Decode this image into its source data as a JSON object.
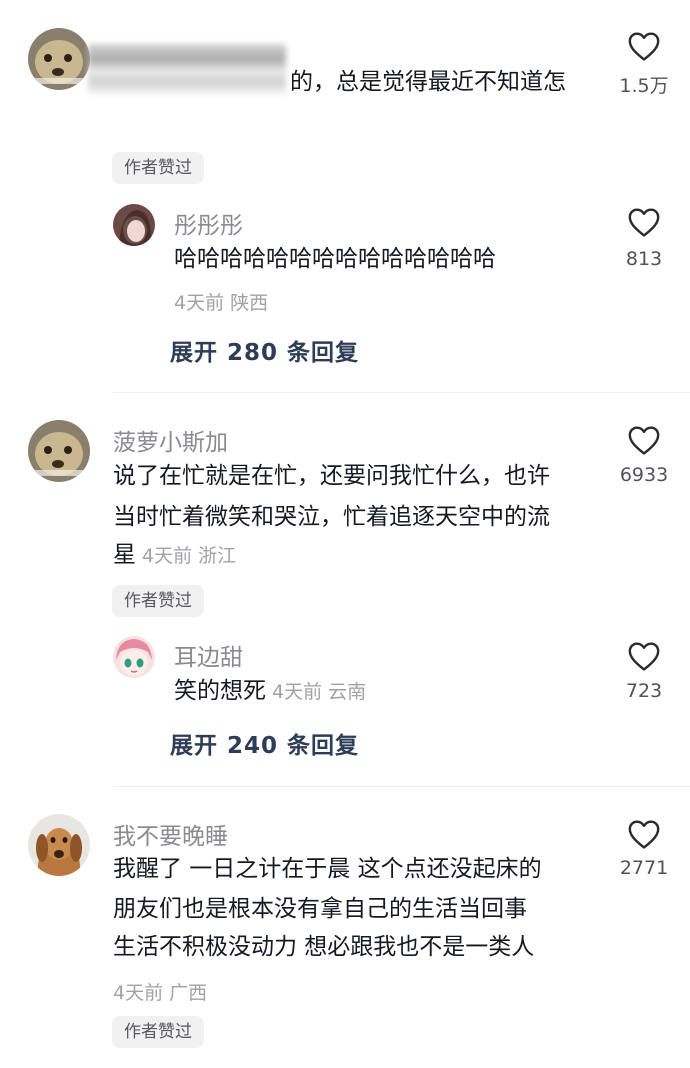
{
  "comments": [
    {
      "text_lines": [
        "的，总是觉得最近不知道怎"
      ],
      "likes": "1.5万",
      "author_badge": "作者赞过",
      "reply": {
        "name": "彤彤彤",
        "text": "哈哈哈哈哈哈哈哈哈哈哈哈哈哈",
        "meta": "4天前 陕西",
        "likes": "813"
      },
      "expand_label": "展开 280 条回复"
    },
    {
      "name": "菠萝小斯加",
      "text_lines": [
        "说了在忙就是在忙，还要问我忙什么，也许",
        "当时忙着微笑和哭泣，忙着追逐天空中的流",
        "星"
      ],
      "meta": "4天前 浙江",
      "likes": "6933",
      "author_badge": "作者赞过",
      "reply": {
        "name": "耳边甜",
        "text": "笑的想死",
        "meta": "4天前 云南",
        "likes": "723"
      },
      "expand_label": "展开 240 条回复"
    },
    {
      "name": "我不要晚睡",
      "text_lines": [
        "我醒了 一日之计在于晨 这个点还没起床的",
        "朋友们也是根本没有拿自己的生活当回事",
        "生活不积极没动力 想必跟我也不是一类人"
      ],
      "meta": "4天前 广西",
      "likes": "2771",
      "author_badge": "作者赞过"
    }
  ],
  "icons": {
    "like": "heart-outline-icon"
  },
  "colors": {
    "text": "#161823",
    "name": "#8a8b91",
    "meta": "#a1a2a7",
    "expand": "#2d3d57",
    "badge_bg": "#f1f1f2"
  }
}
